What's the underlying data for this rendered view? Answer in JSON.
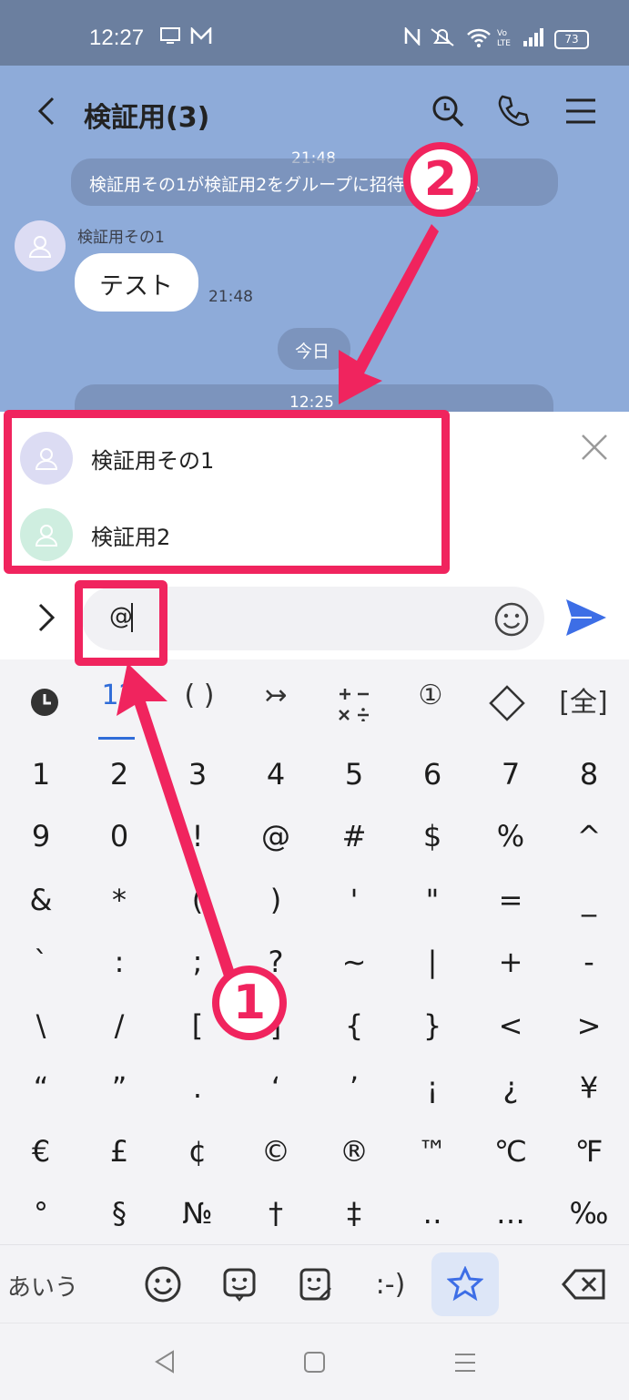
{
  "status_bar": {
    "time": "12:27",
    "battery": "73"
  },
  "header": {
    "title": "検証用(3)"
  },
  "chat": {
    "system_time_1": "21:48",
    "system_msg_1": "検証用その1が検証用2をグループに招待しました。",
    "sender_name": "検証用その1",
    "message_text": "テスト",
    "message_time": "21:48",
    "date_pill": "今日",
    "system_time_2": "12:25"
  },
  "mention_list": {
    "items": [
      {
        "name": "検証用その1",
        "avatar_color": "#dcdcf3"
      },
      {
        "name": "検証用2",
        "avatar_color": "#cfeee0"
      }
    ]
  },
  "input": {
    "value": "@"
  },
  "keyboard": {
    "category_tabs": [
      "recent",
      "1?",
      "( )",
      "↣",
      "+−×÷",
      "①",
      "◇",
      "[全]"
    ],
    "rows": [
      [
        "1",
        "2",
        "3",
        "4",
        "5",
        "6",
        "7",
        "8"
      ],
      [
        "9",
        "0",
        "!",
        "@",
        "#",
        "$",
        "%",
        "^"
      ],
      [
        "&",
        "*",
        "(",
        ")",
        "'",
        "\"",
        "=",
        "_"
      ],
      [
        "`",
        ":",
        ";",
        "?",
        "~",
        "|",
        "+",
        "-"
      ],
      [
        "\\",
        "/",
        "[",
        "]",
        "{",
        "}",
        "<",
        ">"
      ],
      [
        "“",
        "”",
        ".",
        "‘",
        "’",
        "¡",
        "¿",
        "¥"
      ],
      [
        "€",
        "£",
        "¢",
        "©",
        "®",
        "™",
        "℃",
        "℉"
      ],
      [
        "°",
        "§",
        "№",
        "†",
        "‡",
        "‥",
        "…",
        "‰"
      ]
    ],
    "toolbar": {
      "kana_label": "あいう",
      "kaomoji_label": ":-)"
    }
  },
  "annotations": {
    "badge_1": "1",
    "badge_2": "2",
    "color": "#f0245e"
  },
  "colors": {
    "chat_bg": "#8eabd9",
    "status_bg": "#6b7f9f",
    "send": "#3d6ee6"
  }
}
